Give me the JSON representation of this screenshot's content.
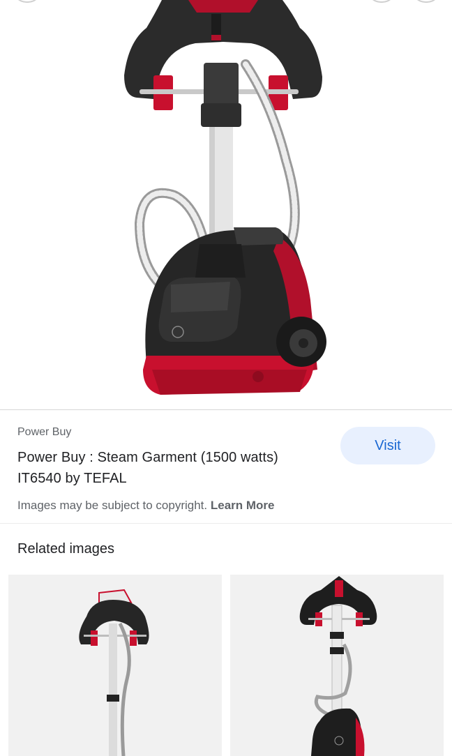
{
  "result": {
    "source": "Power Buy",
    "title": "Power Buy : Steam Garment (1500 watts) IT6540 by TEFAL",
    "visit_label": "Visit",
    "copyright_text": "Images may be subject to copyright.",
    "learn_more_label": "Learn More"
  },
  "related": {
    "heading": "Related images",
    "items": [
      {
        "image": "garment-steamer-thumbnail"
      },
      {
        "image": "garment-steamer-thumbnail"
      }
    ]
  },
  "colors": {
    "accent_red": "#c8102e",
    "visit_bg": "#e8f0fe",
    "visit_text": "#1967d2"
  }
}
